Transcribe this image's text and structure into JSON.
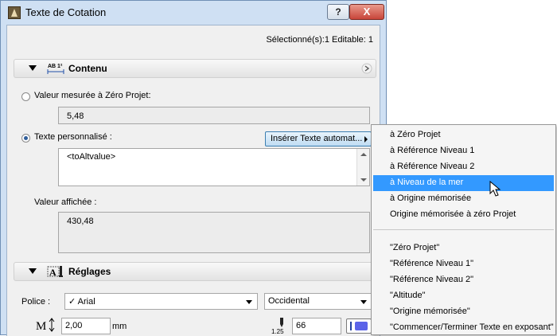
{
  "window": {
    "title": "Texte de Cotation",
    "help_label": "?",
    "close_label": "X",
    "selection_info": "Sélectionné(s):1 Editable: 1"
  },
  "contenu": {
    "title": "Contenu",
    "measured_label": "Valeur mesurée à Zéro Projet:",
    "measured_value": "5,48",
    "custom_label": "Texte personnalisé :",
    "insert_button": "Insérer Texte automat...",
    "custom_text": "<toAltvalue>",
    "displayed_label": "Valeur affichée :",
    "displayed_value": "430,48"
  },
  "reglages": {
    "title": "Réglages",
    "font_label": "Police :",
    "font_value": "✓ Arial",
    "script_value": "Occidental",
    "size_value": "2,00",
    "size_unit": "mm",
    "pen_scale": "1.25",
    "pen_value": "66",
    "pen_color": "#5b63e8"
  },
  "menu": {
    "items": [
      "à Zéro Projet",
      "à Référence Niveau 1",
      "à Référence Niveau 2",
      "à Niveau de la mer",
      "à Origine mémorisée",
      "Origine mémorisée à zéro Projet"
    ],
    "highlighted_index": 3,
    "text_items": [
      "\"Zéro Projet\"",
      "\"Référence Niveau 1\"",
      "\"Référence Niveau 2\"",
      "\"Altitude\"",
      "\"Origine mémorisée\"",
      "\"Commencer/Terminer Texte en exposant\""
    ]
  },
  "colors": {
    "highlight": "#3399ff",
    "accent_radio": "#2f5e9a"
  }
}
